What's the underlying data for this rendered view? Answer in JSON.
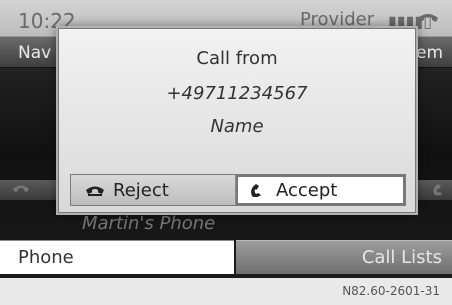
{
  "status": {
    "time": "10:22",
    "provider": "Provider",
    "signal": "▮▮▮▮▯"
  },
  "menu": {
    "left_label": "Nav",
    "right_label": "em"
  },
  "background": {
    "list_text": "Martin's Phone"
  },
  "dialog": {
    "title": "Call from",
    "number": "+49711234567",
    "name": "Name",
    "reject_label": "Reject",
    "accept_label": "Accept"
  },
  "tabs": {
    "phone": "Phone",
    "call_lists": "Call Lists"
  },
  "ref": "N82.60-2601-31"
}
